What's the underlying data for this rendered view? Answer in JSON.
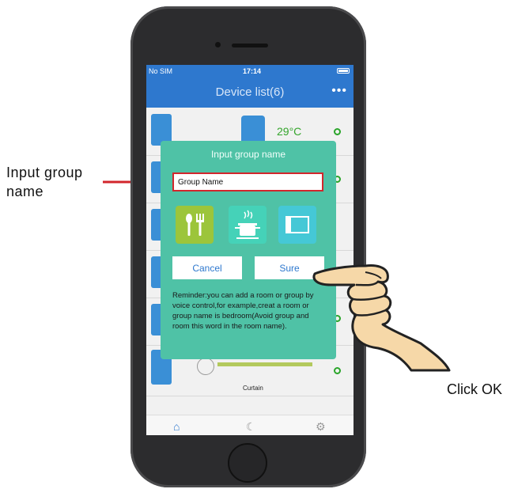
{
  "annotations": {
    "left_label": "Input group name",
    "right_label": "Click OK"
  },
  "status_bar": {
    "carrier": "No SIM",
    "time": "17:14"
  },
  "nav": {
    "title": "Device list(6)",
    "more": "•••"
  },
  "device_list": {
    "temperature": "29°C",
    "curtain_label": "Curtain"
  },
  "dialog": {
    "title": "Input group name",
    "input_value": "Group Name",
    "icons": [
      "dining-icon",
      "kitchen-pot-icon",
      "door-icon"
    ],
    "cancel_label": "Cancel",
    "sure_label": "Sure",
    "reminder": "Reminder:you can add a room or group by voice control,for example,creat a room or group name is bedroom(Avoid group and room this word in the room name)."
  },
  "tabbar": {
    "icons": [
      "home-icon",
      "scene-icon",
      "settings-icon"
    ]
  },
  "colors": {
    "nav_blue": "#2e78ce",
    "dialog_green": "#4fc2a6",
    "input_border_red": "#d2262c",
    "temp_green": "#35a52c"
  }
}
